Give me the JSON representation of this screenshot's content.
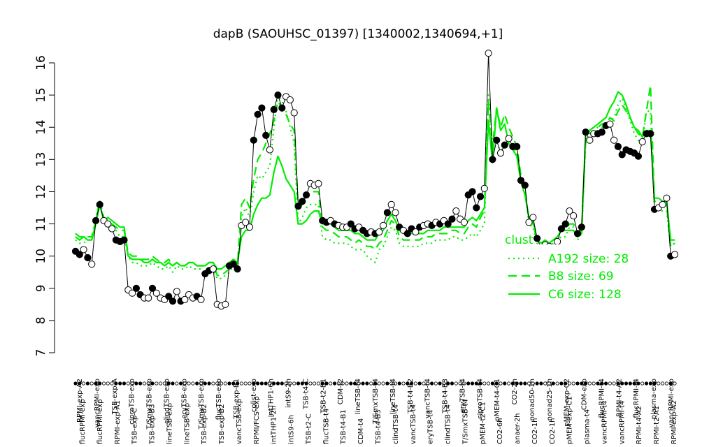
{
  "chart_data": {
    "type": "line",
    "title": "dapB (SAOUHSC_01397) [1340002,1340694,+1]",
    "xlabel": "",
    "ylabel": "",
    "ylim": [
      7,
      16
    ],
    "yticks": [
      7,
      8,
      9,
      10,
      11,
      12,
      13,
      14,
      15,
      16
    ],
    "x_labels_top": [
      "RPMI-exp-A2",
      "vancRPMI-exp",
      "TSB-exp-A",
      "ciproTSB-exp",
      "T/SmxTSB-exp",
      "clindTSB-exp",
      "eryTSB-exp",
      "T/SmxTSB-exp",
      "flucTSB-exp",
      "TSB-exp-B1",
      "colist-exp",
      "intTHP1-6h",
      "intS9-2h",
      "TSB-t4-C",
      "TSB-t2-B1",
      "CDM-t2",
      "lineTSB-t4",
      "T/SmxTSB-t4",
      "lineTSB-t4",
      "TSB-t4-B2",
      "vancTSB-t4",
      "TSB-t4-B3",
      "eryTSB-t4",
      "ciproTSB-t4",
      "pMEM-t4-C1",
      "CO2-2h",
      "nonad50-1h",
      "nonad25-1h",
      "pMEM-exp-C2",
      "CDM-exp",
      "flucRPMI-t4",
      "RPMI-t4-A2",
      "flucRPMI-t4",
      "plasma-exp",
      "vancRPMI-exp"
    ],
    "x_labels_bottom": [
      "flucRPMI-exp",
      "flucRPMI-exp",
      "RPMI-exp-A1",
      "TSB-exp-C",
      "TSB-exp-B3",
      "lineTSB-exp",
      "lineTSB-exp",
      "TSB-exp-B2",
      "TSB-exp-B2",
      "vancTSB-exp",
      "RPMI/FCS-exp",
      "intTHP1-2h",
      "intS9-6h",
      "TSB-t2-C",
      "flucTSB-t4",
      "TSB-t4-B1",
      "CDM-t4",
      "TSB-t4-B3",
      "clindTSB-t4",
      "vancTSB-t4",
      "eryTSB-t4",
      "clindTSB-t4",
      "T/SmxTSB-t4",
      "pMEM-t2-C1",
      "CO2-6h",
      "anaer-2h",
      "CO2-1h",
      "CO2-1h",
      "pMEM-exp-C1",
      "plasma-t4",
      "vancRPMI-t4",
      "vancRPMI-t4",
      "RPMI-t4-A2",
      "RPMI-t2-A1",
      "RPMI-exp-A2"
    ],
    "series": [
      {
        "name": "",
        "kind": "expression",
        "values": [
          10.15,
          10.05,
          10.2,
          9.95,
          9.75,
          11.1,
          11.6,
          11.1,
          11.0,
          10.85,
          10.5,
          10.45,
          10.5,
          8.95,
          8.85,
          9.0,
          8.8,
          8.7,
          8.7,
          9.0,
          8.85,
          8.7,
          8.65,
          8.75,
          8.6,
          8.9,
          8.6,
          8.65,
          8.8,
          8.7,
          8.75,
          8.65,
          9.45,
          9.55,
          9.6,
          8.5,
          8.45,
          8.5,
          9.7,
          9.75,
          9.6,
          10.95,
          11.05,
          10.9,
          13.6,
          14.4,
          14.6,
          13.75,
          13.3,
          14.55,
          15.0,
          14.6,
          14.95,
          14.85,
          14.45,
          11.55,
          11.7,
          11.9,
          12.25,
          12.2,
          12.25,
          11.1,
          11.05,
          11.1,
          11.0,
          10.95,
          10.9,
          10.9,
          11.0,
          10.85,
          10.9,
          10.8,
          10.7,
          10.75,
          10.7,
          10.75,
          10.95,
          11.35,
          11.6,
          11.35,
          10.9,
          10.8,
          10.7,
          10.85,
          10.75,
          10.9,
          10.95,
          11.0,
          10.95,
          11.05,
          11.0,
          11.1,
          11.0,
          11.15,
          11.4,
          11.15,
          11.05,
          11.9,
          12.0,
          11.5,
          11.85,
          12.1,
          16.3,
          13.0,
          13.6,
          13.2,
          13.45,
          13.65,
          13.4,
          13.4,
          12.35,
          12.2,
          11.05,
          11.2,
          10.55,
          10.25,
          10.35,
          10.3,
          10.2,
          10.45,
          10.85,
          11.0,
          11.4,
          11.25,
          10.7,
          10.9,
          13.85,
          13.6,
          13.8,
          13.8,
          13.85,
          14.05,
          14.1,
          13.6,
          13.4,
          13.15,
          13.3,
          13.25,
          13.2,
          13.1,
          13.55,
          13.8,
          13.8,
          11.45,
          11.5,
          11.6,
          11.8,
          10.0,
          10.05
        ],
        "markers_filled": [
          1,
          1,
          0,
          1,
          0,
          1,
          1,
          0,
          0,
          0,
          1,
          1,
          1,
          0,
          0,
          1,
          1,
          0,
          0,
          1,
          0,
          0,
          0,
          1,
          1,
          0,
          1,
          0,
          0,
          0,
          1,
          0,
          1,
          1,
          0,
          0,
          0,
          0,
          1,
          1,
          1,
          0,
          0,
          0,
          1,
          1,
          1,
          1,
          0,
          1,
          1,
          1,
          0,
          0,
          0,
          1,
          1,
          1,
          0,
          0,
          0,
          1,
          1,
          0,
          1,
          0,
          0,
          0,
          1,
          1,
          0,
          1,
          1,
          0,
          1,
          0,
          0,
          1,
          0,
          0,
          1,
          0,
          1,
          1,
          0,
          1,
          0,
          0,
          1,
          0,
          1,
          0,
          1,
          1,
          0,
          0,
          0,
          1,
          1,
          1,
          1,
          0,
          0,
          1,
          1,
          0,
          1,
          0,
          1,
          1,
          1,
          1,
          0,
          0,
          1,
          1,
          0,
          0,
          1,
          0,
          1,
          1,
          0,
          0,
          1,
          1,
          1,
          0,
          0,
          1,
          1,
          1,
          0,
          0,
          1,
          1,
          1,
          1,
          1,
          1,
          0,
          1,
          1,
          1,
          0,
          0,
          0,
          1,
          0
        ]
      },
      {
        "name": "A192 size: 28",
        "style": "dotted",
        "values": [
          10.5,
          10.4,
          10.4,
          10.5,
          10.5,
          11.2,
          11.7,
          11.1,
          11.0,
          10.9,
          10.8,
          10.6,
          10.6,
          10.0,
          9.8,
          9.8,
          9.7,
          9.7,
          9.7,
          9.8,
          9.7,
          9.6,
          9.6,
          9.7,
          9.5,
          9.7,
          9.6,
          9.6,
          9.7,
          9.6,
          9.6,
          9.6,
          9.5,
          9.6,
          9.6,
          9.3,
          9.3,
          9.4,
          9.5,
          9.7,
          9.6,
          11.2,
          11.5,
          11.2,
          12.0,
          12.5,
          12.4,
          12.6,
          12.8,
          14.0,
          15.0,
          14.8,
          14.5,
          14.0,
          13.5,
          11.0,
          11.2,
          11.5,
          11.6,
          11.6,
          11.6,
          10.6,
          10.5,
          10.5,
          10.4,
          10.4,
          10.4,
          10.4,
          10.3,
          10.2,
          10.2,
          10.2,
          10.0,
          9.9,
          9.8,
          10.2,
          10.3,
          10.6,
          10.9,
          10.8,
          10.4,
          10.3,
          10.3,
          10.3,
          10.3,
          10.3,
          10.4,
          10.4,
          10.4,
          10.5,
          10.5,
          10.5,
          10.5,
          10.6,
          10.6,
          10.5,
          10.5,
          10.6,
          10.7,
          10.6,
          10.8,
          11.0,
          15.0,
          13.3,
          13.6,
          13.2,
          13.5,
          13.5,
          13.4,
          13.2,
          12.4,
          12.0,
          11.0,
          10.9,
          10.4,
          10.3,
          10.4,
          10.3,
          10.4,
          10.5,
          10.6,
          10.6,
          10.9,
          10.9,
          10.5,
          10.7,
          13.5,
          13.8,
          13.9,
          14.0,
          14.0,
          14.0,
          14.2,
          14.3,
          14.7,
          14.9,
          14.6,
          14.2,
          13.8,
          13.6,
          13.5,
          14.5,
          14.5,
          11.5,
          11.4,
          11.4,
          11.4,
          10.3,
          10.4
        ]
      },
      {
        "name": "B8 size: 69",
        "style": "dashed",
        "values": [
          10.7,
          10.6,
          10.6,
          10.6,
          10.6,
          11.1,
          11.7,
          11.2,
          11.1,
          11.0,
          10.9,
          10.8,
          10.8,
          10.1,
          10.0,
          10.0,
          9.9,
          9.9,
          9.9,
          10.0,
          9.9,
          9.8,
          9.8,
          9.9,
          9.7,
          9.8,
          9.7,
          9.7,
          9.8,
          9.8,
          9.7,
          9.7,
          9.7,
          9.8,
          9.8,
          9.4,
          9.4,
          9.5,
          9.6,
          9.8,
          9.7,
          11.6,
          11.8,
          11.5,
          12.4,
          13.0,
          13.2,
          13.5,
          13.8,
          14.2,
          14.8,
          14.6,
          14.4,
          14.1,
          13.9,
          11.5,
          11.6,
          11.9,
          12.0,
          12.0,
          12.0,
          10.9,
          10.8,
          10.8,
          10.7,
          10.6,
          10.6,
          10.6,
          10.5,
          10.4,
          10.5,
          10.4,
          10.3,
          10.3,
          10.2,
          10.4,
          10.5,
          10.8,
          11.1,
          11.0,
          10.6,
          10.5,
          10.5,
          10.5,
          10.5,
          10.5,
          10.6,
          10.6,
          10.6,
          10.7,
          10.7,
          10.7,
          10.7,
          10.8,
          10.8,
          10.7,
          10.7,
          10.9,
          11.0,
          10.9,
          11.2,
          11.4,
          14.8,
          13.4,
          14.6,
          14.0,
          14.4,
          14.0,
          13.7,
          13.4,
          12.5,
          12.1,
          11.1,
          11.0,
          10.5,
          10.4,
          10.5,
          10.4,
          10.5,
          10.6,
          10.8,
          10.8,
          11.0,
          11.0,
          10.7,
          10.8,
          13.6,
          13.9,
          14.0,
          14.0,
          14.1,
          14.1,
          14.3,
          14.2,
          14.5,
          14.7,
          14.5,
          14.3,
          14.0,
          13.8,
          13.7,
          14.5,
          15.3,
          11.7,
          11.7,
          11.6,
          11.6,
          10.3,
          10.4
        ]
      },
      {
        "name": "C6 size: 128",
        "style": "solid",
        "values": [
          10.6,
          10.5,
          10.6,
          10.5,
          10.5,
          11.0,
          11.6,
          11.1,
          11.2,
          11.1,
          11.0,
          10.9,
          10.9,
          10.0,
          9.9,
          9.9,
          9.9,
          9.8,
          9.8,
          9.9,
          9.8,
          9.8,
          9.7,
          9.8,
          9.7,
          9.8,
          9.7,
          9.7,
          9.8,
          9.8,
          9.7,
          9.7,
          9.7,
          9.8,
          9.8,
          9.6,
          9.6,
          9.7,
          9.8,
          9.9,
          9.8,
          10.6,
          10.8,
          10.8,
          11.3,
          11.6,
          11.8,
          11.8,
          11.9,
          12.6,
          13.1,
          12.8,
          12.4,
          12.2,
          12.0,
          11.0,
          11.0,
          11.1,
          11.3,
          11.4,
          11.4,
          11.0,
          11.0,
          11.0,
          10.9,
          10.8,
          10.8,
          10.8,
          10.8,
          10.7,
          10.7,
          10.6,
          10.5,
          10.5,
          10.5,
          10.7,
          10.8,
          11.1,
          11.3,
          11.1,
          10.8,
          10.7,
          10.7,
          10.7,
          10.7,
          10.7,
          10.7,
          10.8,
          10.8,
          10.8,
          10.8,
          10.9,
          10.9,
          10.9,
          10.9,
          10.9,
          10.9,
          11.1,
          11.2,
          11.1,
          11.3,
          11.5,
          14.2,
          12.9,
          14.6,
          13.9,
          14.1,
          13.5,
          13.3,
          13.1,
          12.3,
          11.9,
          11.2,
          11.1,
          10.5,
          10.4,
          10.5,
          10.4,
          10.5,
          10.6,
          10.8,
          10.8,
          10.8,
          10.8,
          10.6,
          10.7,
          13.8,
          13.9,
          14.0,
          14.1,
          14.2,
          14.3,
          14.6,
          14.8,
          15.1,
          15.0,
          14.7,
          14.3,
          14.0,
          13.9,
          13.7,
          13.9,
          13.9,
          11.8,
          11.8,
          11.7,
          11.7,
          10.5,
          10.5
        ]
      }
    ],
    "legend": {
      "title": "clust",
      "position": "right",
      "entries": [
        "A192 size: 28",
        "B8 size: 69",
        "C6 size: 128"
      ]
    },
    "colors": {
      "expression": "#000000",
      "clusters": "#00ee00"
    },
    "grid": false
  }
}
